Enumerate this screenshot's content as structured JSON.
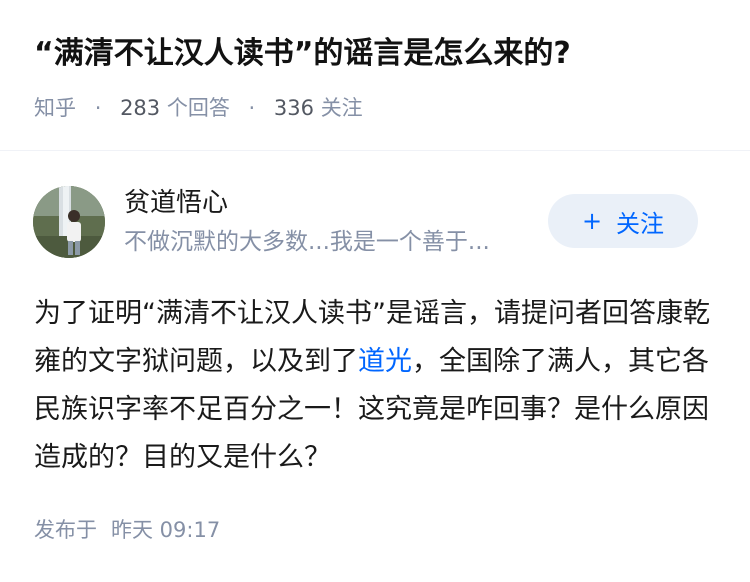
{
  "question": {
    "title": "“满清不让汉人读书”的谣言是怎么来的?",
    "source": "知乎",
    "answer_count": "283",
    "answer_label": "个回答",
    "follow_count": "336",
    "follow_label": "关注",
    "separator": "·"
  },
  "author": {
    "name": "贫道悟心",
    "bio": "不做沉默的大多数...我是一个善于...",
    "follow_button": {
      "icon": "plus-icon",
      "plus": "+",
      "label": "关注"
    }
  },
  "answer": {
    "segments": [
      {
        "text": "为了证明“满清不让汉人读书”是谣言，请提问者回答康乾雍的文字狱问题，以及到了"
      },
      {
        "text": "道光",
        "link": true
      },
      {
        "text": "，全国除了满人，其它各民族识字率不足百分之一！这究竟是咋回事？是什么原因造成的？目的又是什么？"
      }
    ]
  },
  "publish": {
    "label": "发布于",
    "date": "昨天 09:17"
  },
  "colors": {
    "accent": "#0066ff",
    "meta_gray": "#8590a6",
    "button_bg": "#eaf0f8"
  }
}
